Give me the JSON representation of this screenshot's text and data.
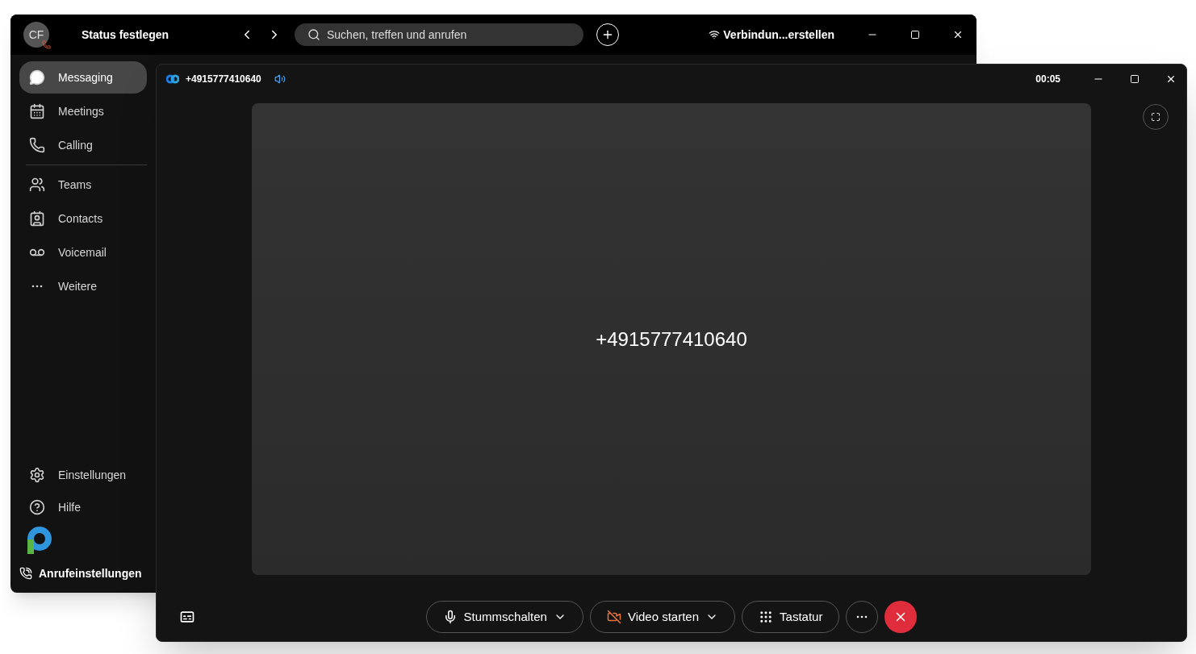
{
  "main_window": {
    "avatar_initials": "CF",
    "status": "Status festlegen",
    "search": {
      "placeholder": "Suchen, treffen und anrufen"
    },
    "connection": "Verbindun...erstellen"
  },
  "sidebar": {
    "top_items": [
      {
        "label": "Messaging",
        "selected": true
      },
      {
        "label": "Meetings",
        "selected": false
      },
      {
        "label": "Calling",
        "selected": false
      }
    ],
    "more_items": [
      {
        "label": "Teams",
        "selected": false
      },
      {
        "label": "Contacts",
        "selected": false
      },
      {
        "label": "Voicemail",
        "selected": false
      },
      {
        "label": "Weitere",
        "selected": false
      }
    ],
    "bottom_items": [
      {
        "label": "Einstellungen"
      },
      {
        "label": "Hilfe"
      }
    ],
    "call_settings": "Anrufeinstellungen"
  },
  "call_window": {
    "title": "+4915777410640",
    "timer": "00:05",
    "caller": "+4915777410640",
    "controls": [
      {
        "kind": "mute",
        "label": "Stummschalten",
        "dropdown": true
      },
      {
        "kind": "video",
        "label": "Video starten",
        "dropdown": true,
        "video_off": true
      },
      {
        "kind": "keypad",
        "label": "Tastatur",
        "dropdown": false
      }
    ]
  }
}
